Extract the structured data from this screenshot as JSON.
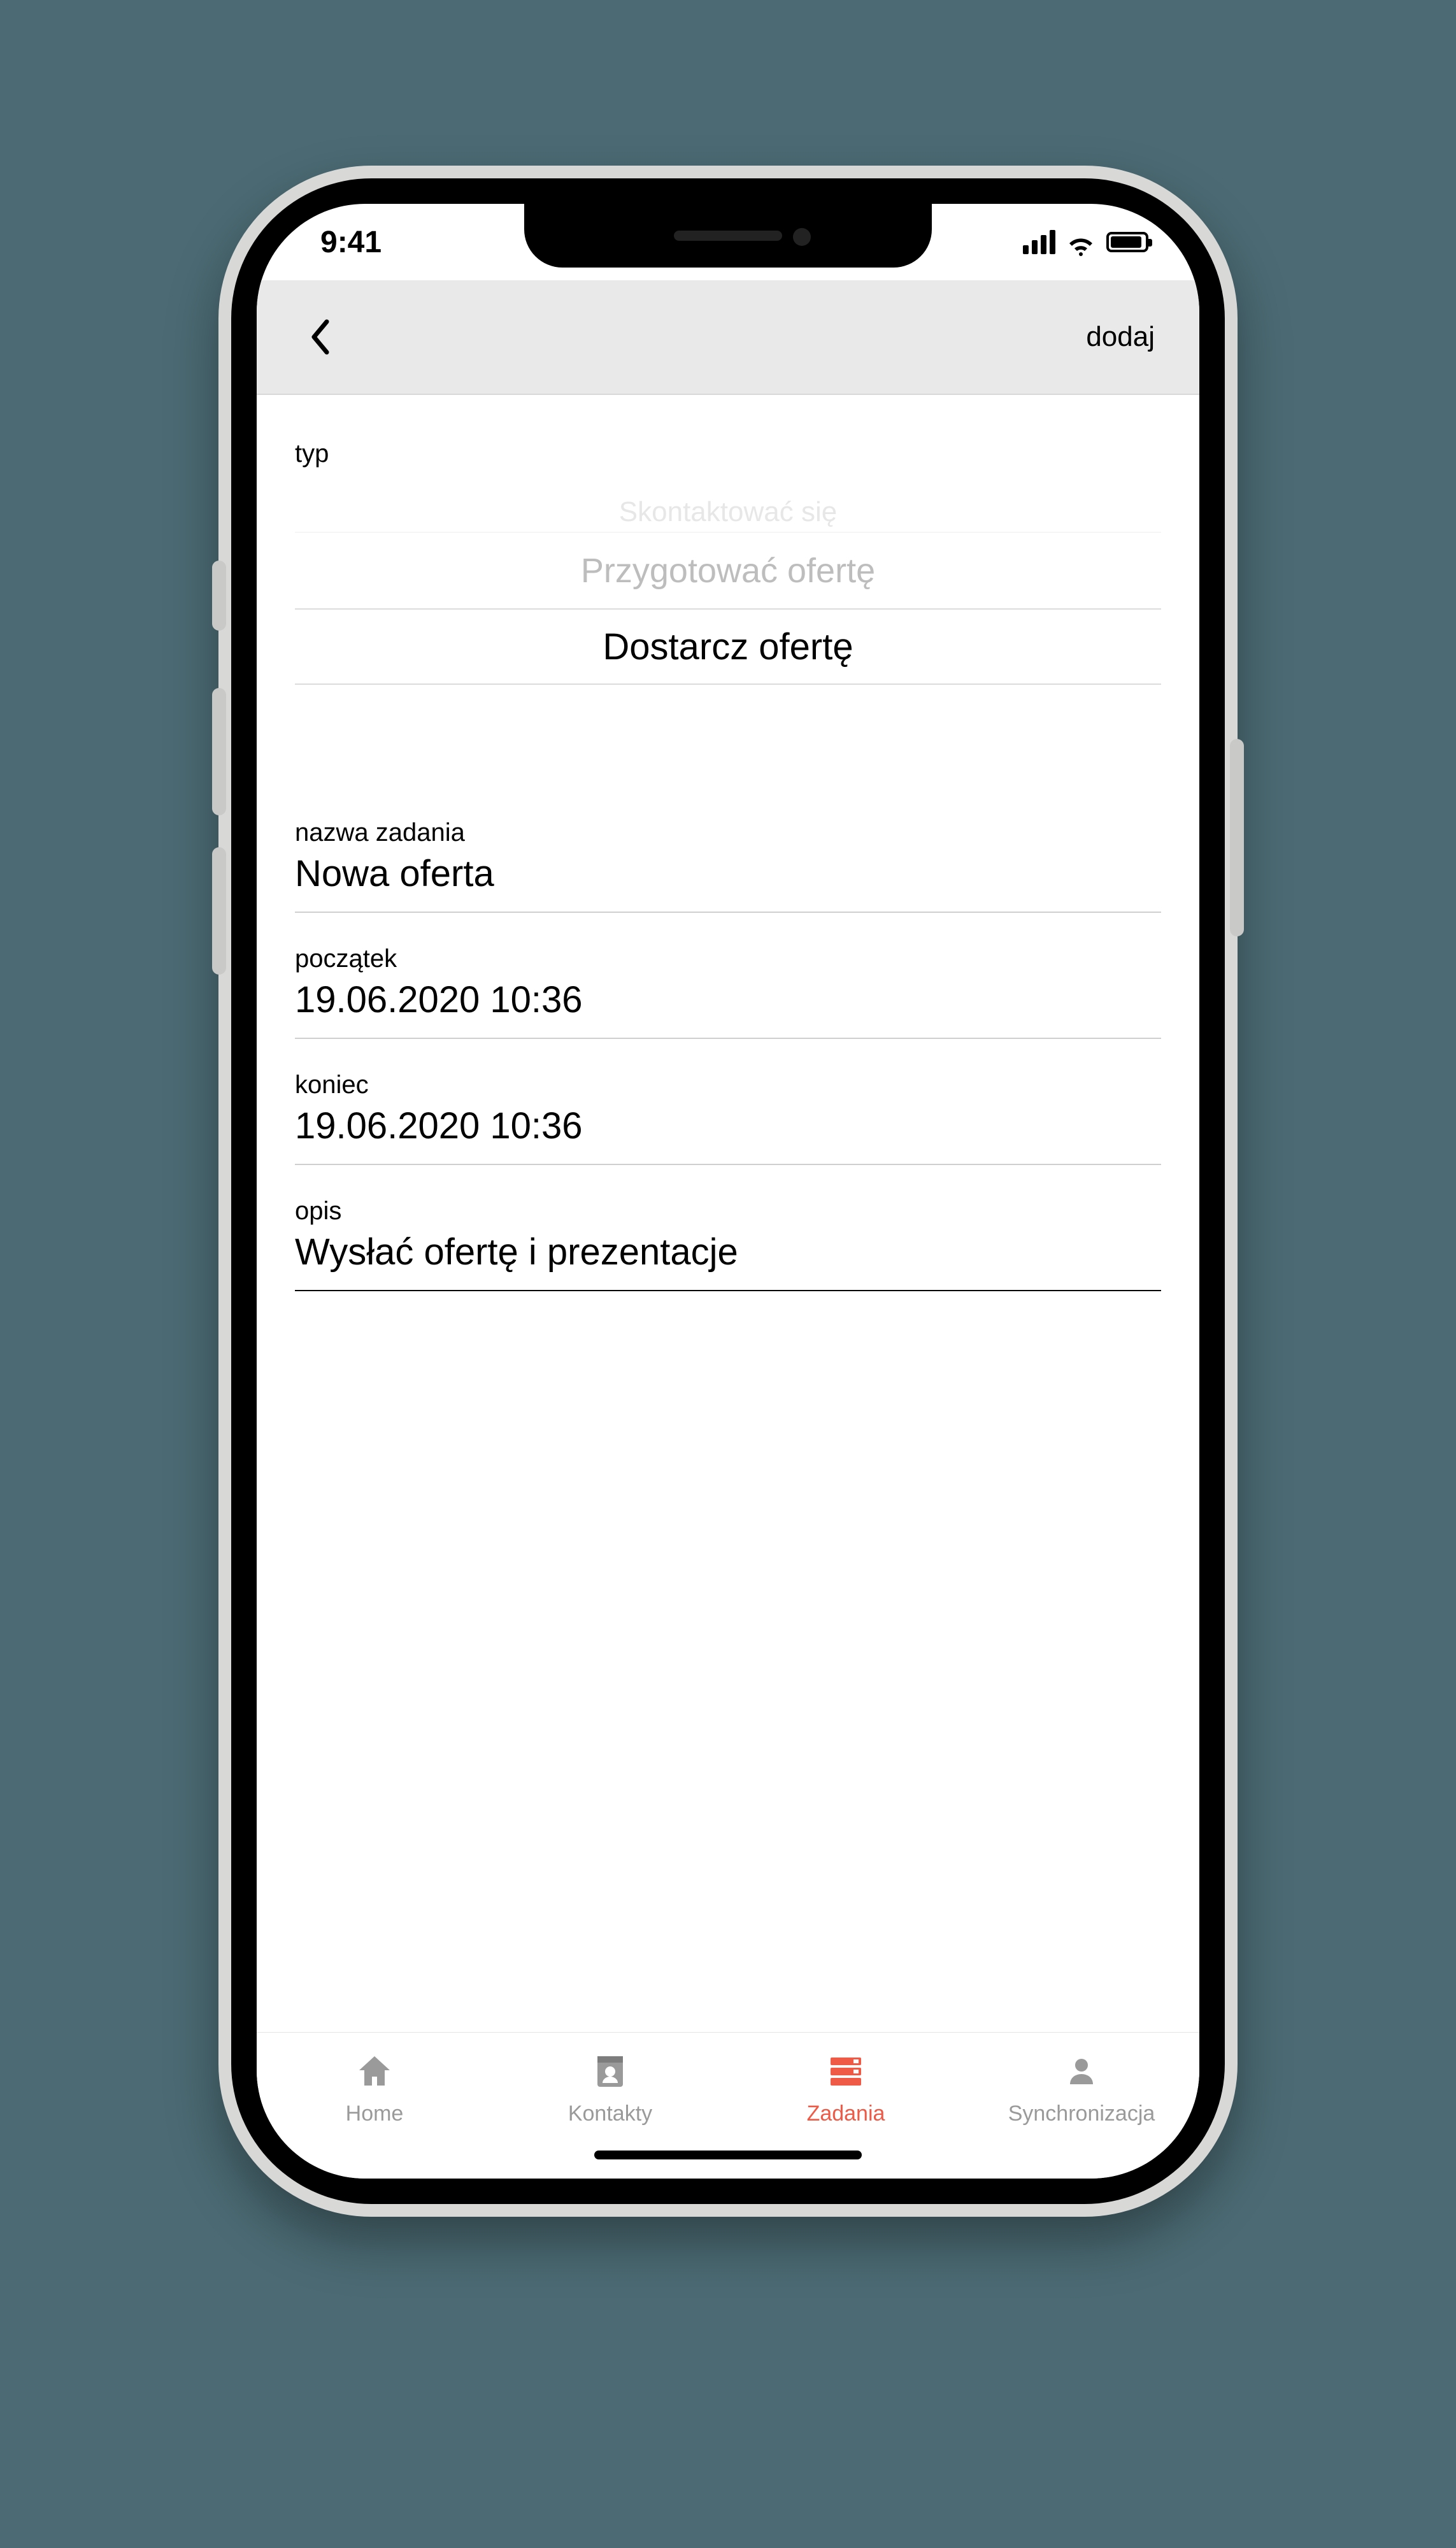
{
  "status": {
    "time": "9:41"
  },
  "header": {
    "add_label": "dodaj"
  },
  "form": {
    "type_label": "typ",
    "picker": {
      "option_faded": "Skontaktować się",
      "option_above": "Przygotować ofertę",
      "option_selected": "Dostarcz ofertę"
    },
    "task_name": {
      "label": "nazwa zadania",
      "value": "Nowa oferta"
    },
    "start": {
      "label": "początek",
      "value": "19.06.2020 10:36"
    },
    "end": {
      "label": "koniec",
      "value": "19.06.2020 10:36"
    },
    "description": {
      "label": "opis",
      "value": "Wysłać ofertę i prezentacje"
    }
  },
  "tabs": {
    "home": "Home",
    "contacts": "Kontakty",
    "tasks": "Zadania",
    "sync": "Synchronizacja"
  }
}
